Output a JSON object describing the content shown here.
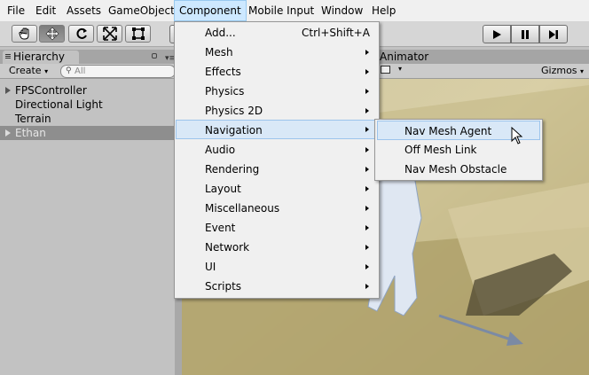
{
  "menubar": {
    "items": [
      {
        "label": "File"
      },
      {
        "label": "Edit"
      },
      {
        "label": "Assets"
      },
      {
        "label": "GameObject"
      },
      {
        "label": "Component",
        "active": true
      },
      {
        "label": "Mobile Input"
      },
      {
        "label": "Window"
      },
      {
        "label": "Help"
      }
    ]
  },
  "toolbar": {
    "tools": [
      "hand-icon",
      "move-icon",
      "rotate-icon",
      "scale-icon",
      "rect-tool-icon"
    ],
    "selected_tool": "move-icon",
    "playback": [
      "play-icon",
      "pause-icon",
      "step-icon"
    ]
  },
  "hierarchy": {
    "tab_label": "Hierarchy",
    "create_label": "Create",
    "search_placeholder": "All",
    "items": [
      {
        "label": "FPSController",
        "expandable": true
      },
      {
        "label": "Directional Light"
      },
      {
        "label": "Terrain"
      },
      {
        "label": "Ethan",
        "expandable": true,
        "selected": true
      }
    ]
  },
  "scene": {
    "animator_tab": "Animator",
    "gizmos_label": "Gizmos"
  },
  "component_menu": {
    "items": [
      {
        "label": "Add...",
        "shortcut": "Ctrl+Shift+A"
      },
      {
        "label": "Mesh",
        "submenu": true
      },
      {
        "label": "Effects",
        "submenu": true
      },
      {
        "label": "Physics",
        "submenu": true
      },
      {
        "label": "Physics 2D",
        "submenu": true
      },
      {
        "label": "Navigation",
        "submenu": true,
        "highlighted": true
      },
      {
        "label": "Audio",
        "submenu": true
      },
      {
        "label": "Rendering",
        "submenu": true
      },
      {
        "label": "Layout",
        "submenu": true
      },
      {
        "label": "Miscellaneous",
        "submenu": true
      },
      {
        "label": "Event",
        "submenu": true
      },
      {
        "label": "Network",
        "submenu": true
      },
      {
        "label": "UI",
        "submenu": true
      },
      {
        "label": "Scripts",
        "submenu": true
      }
    ]
  },
  "navigation_submenu": {
    "items": [
      {
        "label": "Nav Mesh Agent",
        "highlighted": true
      },
      {
        "label": "Off Mesh Link"
      },
      {
        "label": "Nav Mesh Obstacle"
      }
    ]
  },
  "colors": {
    "menu_highlight": "#d9e8f7",
    "menu_highlight_border": "#9cc4ec",
    "selection": "#8e8e8e"
  }
}
